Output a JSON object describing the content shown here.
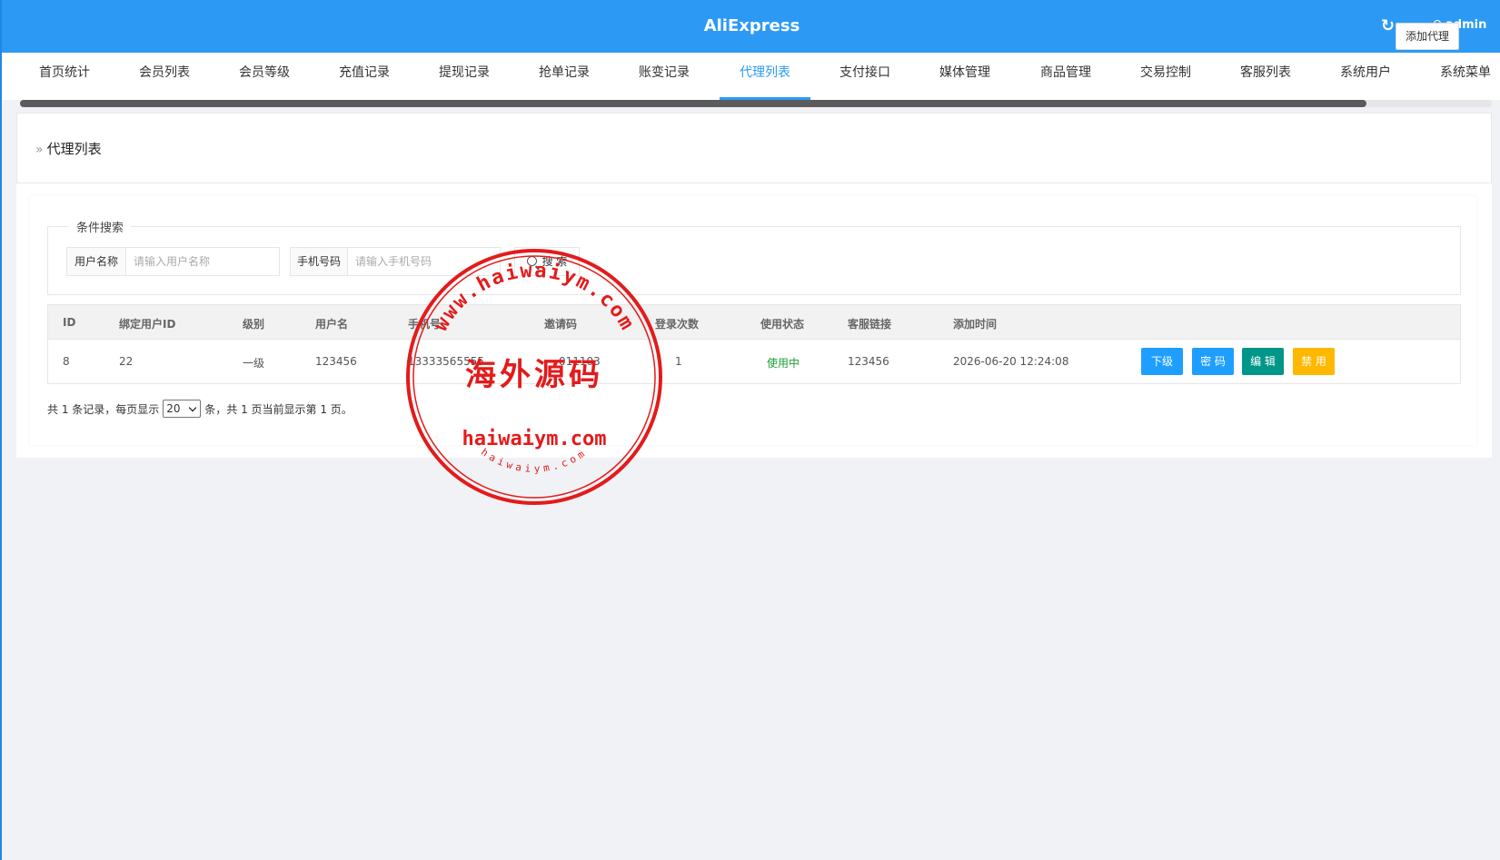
{
  "app": {
    "title": "AliExpress",
    "user": "admin"
  },
  "tabs": [
    {
      "label": "首页统计"
    },
    {
      "label": "会员列表"
    },
    {
      "label": "会员等级"
    },
    {
      "label": "充值记录"
    },
    {
      "label": "提现记录"
    },
    {
      "label": "抢单记录"
    },
    {
      "label": "账变记录"
    },
    {
      "label": "代理列表",
      "active": true
    },
    {
      "label": "支付接口"
    },
    {
      "label": "媒体管理"
    },
    {
      "label": "商品管理"
    },
    {
      "label": "交易控制"
    },
    {
      "label": "客服列表"
    },
    {
      "label": "系统用户"
    },
    {
      "label": "系统菜单"
    }
  ],
  "page": {
    "breadcrumb": "代理列表",
    "add_button": "添加代理"
  },
  "search": {
    "legend": "条件搜索",
    "username_label": "用户名称",
    "username_placeholder": "请输入用户名称",
    "phone_label": "手机号码",
    "phone_placeholder": "请输入手机号码",
    "button": "搜 索"
  },
  "table": {
    "columns": [
      "ID",
      "绑定用户ID",
      "级别",
      "用户名",
      "手机号",
      "邀请码",
      "登录次数",
      "使用状态",
      "客服链接",
      "添加时间"
    ],
    "rows": [
      {
        "id": "8",
        "bind_user_id": "22",
        "level": "一级",
        "username": "123456",
        "phone": "13333565555",
        "invite_code": "011103",
        "login_count": "1",
        "status": "使用中",
        "service_link": "123456",
        "added_time": "2026-06-20 12:24:08",
        "actions": [
          "下级",
          "密 码",
          "编 辑",
          "禁 用"
        ]
      }
    ]
  },
  "pagination": {
    "text_before": "共 1 条记录，每页显示",
    "page_size": "20",
    "text_after": "条，共 1 页当前显示第 1 页。"
  },
  "watermark": {
    "top_arc": "www.haiwaiym.com",
    "center": "海外源码",
    "bottom_line": "haiwaiym.com",
    "bottom_arc": "haiwaiym.com",
    "color": "#e31b1b"
  },
  "colors": {
    "primary": "#2c9af5",
    "blue_button": "#1e9fff",
    "teal_button": "#009688",
    "orange_button": "#ffb800",
    "status_green": "#1aa034"
  }
}
